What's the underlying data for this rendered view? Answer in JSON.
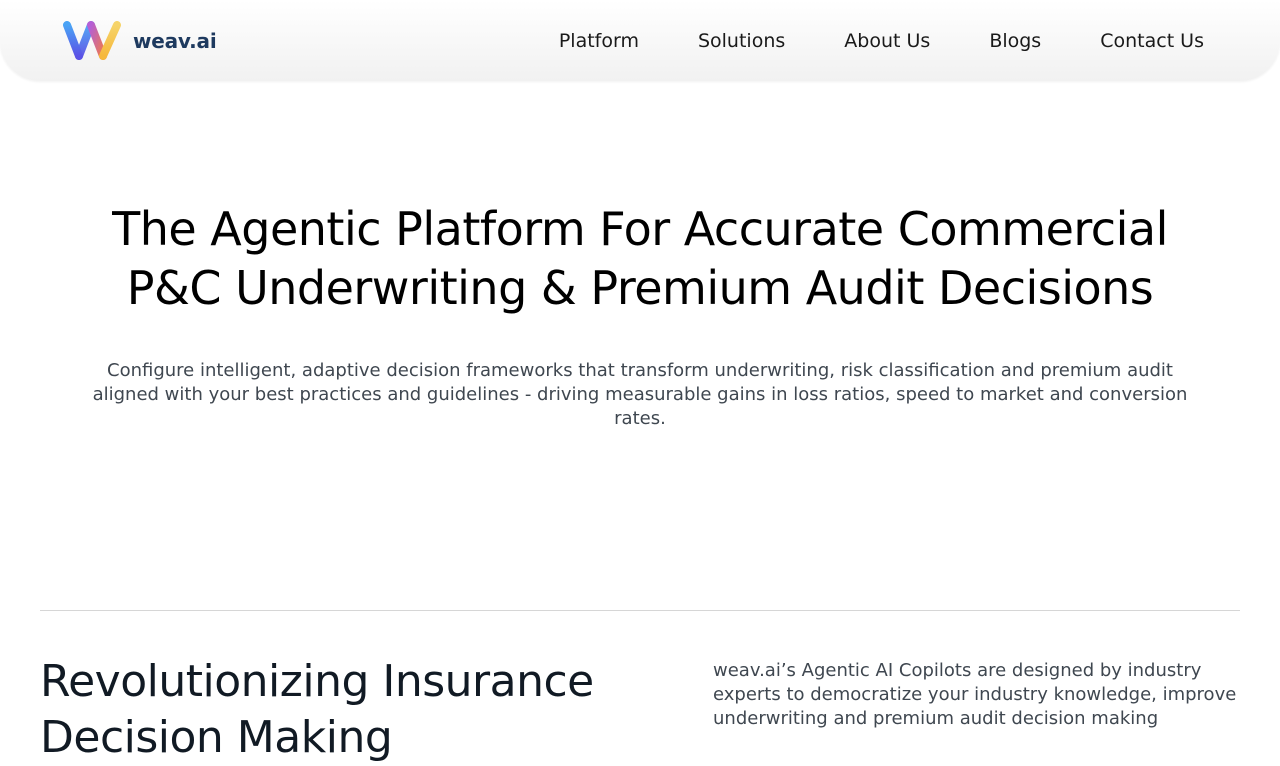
{
  "nav": {
    "brand": "weav.ai",
    "links": [
      "Platform",
      "Solutions",
      "About Us",
      "Blogs",
      "Contact Us"
    ]
  },
  "hero": {
    "title": "The Agentic Platform For Accurate Commercial P&C Underwriting & Premium Audit Decisions",
    "subtitle": "Configure intelligent, adaptive decision frameworks that transform underwriting, risk classification and premium audit aligned with your best practices and guidelines - driving measurable gains in loss ratios, speed to market and conversion rates."
  },
  "section": {
    "title": "Revolutionizing Insurance Decision Making",
    "text": "weav.ai’s Agentic AI Copilots are designed by industry experts to democratize your industry knowledge, improve underwriting and premium audit decision making"
  },
  "colors": {
    "brand_text": "#1e3a5f",
    "logo_blue": "#4f7df3",
    "logo_red": "#e8705a",
    "logo_yellow": "#f7c94b"
  }
}
